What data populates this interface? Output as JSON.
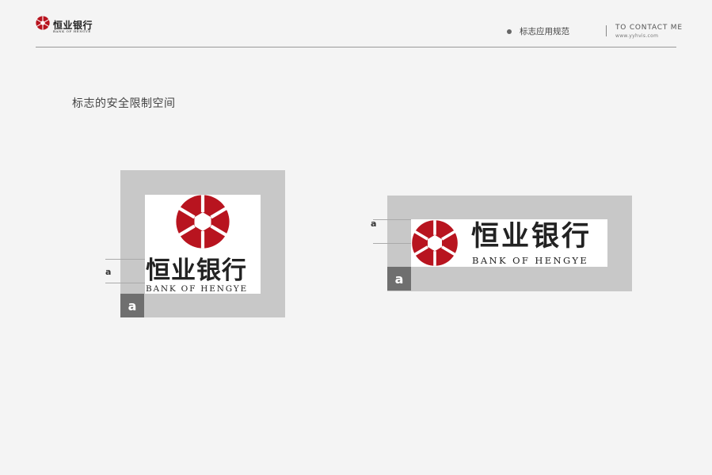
{
  "header": {
    "brand": {
      "name_cn": "恒业银行",
      "name_en": "BANK OF HENGYE"
    },
    "nav": {
      "label": "标志应用规范"
    },
    "contact": {
      "title": "TO CONTACT ME",
      "url": "www.yyhvis.com"
    }
  },
  "section": {
    "title": "标志的安全限制空间"
  },
  "vertical_layout": {
    "logo_cn": "恒业银行",
    "logo_en": "BANK OF HENGYE",
    "measure_label": "a",
    "unit_box_label": "a"
  },
  "horizontal_layout": {
    "logo_cn": "恒业银行",
    "logo_en": "BANK OF HENGYE",
    "measure_label": "a",
    "unit_box_label": "a"
  },
  "colors": {
    "brand_red": "#b8141f",
    "background": "#f4f4f4",
    "zone_gray": "#c8c8c8",
    "unit_gray": "#6f6f6f"
  }
}
